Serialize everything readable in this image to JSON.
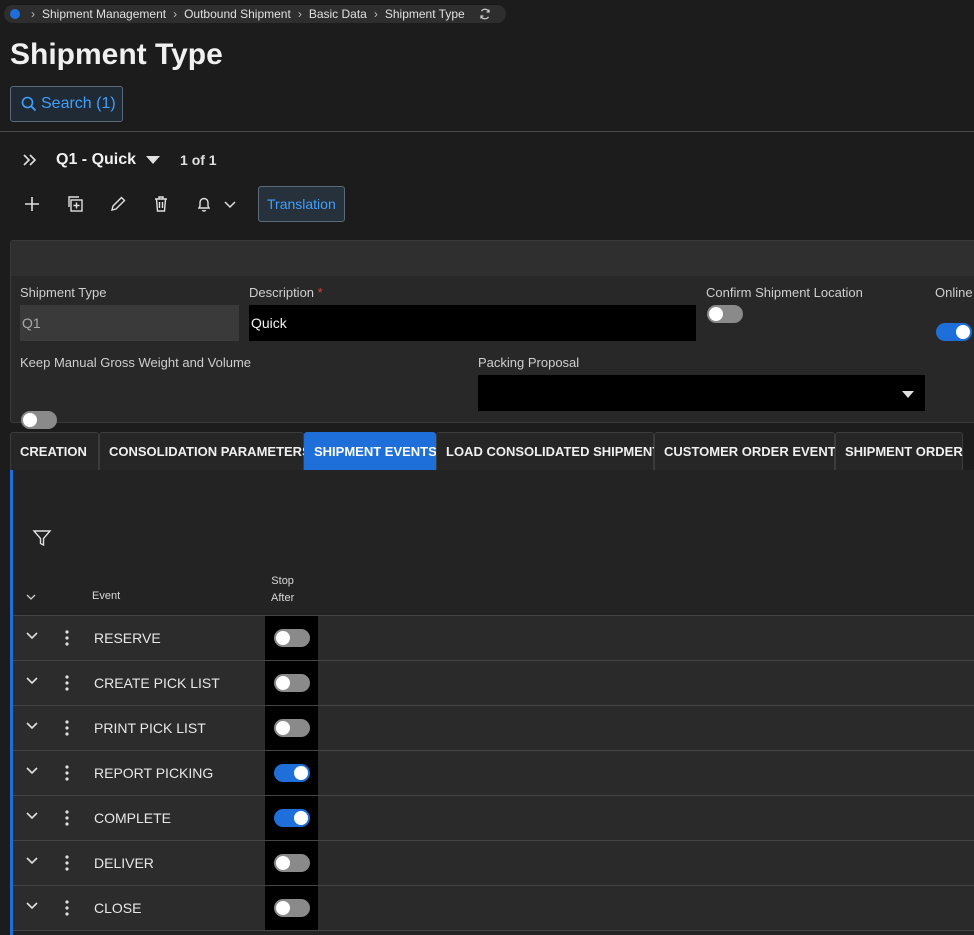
{
  "breadcrumb": {
    "items": [
      "Shipment Management",
      "Outbound Shipment",
      "Basic Data",
      "Shipment Type"
    ]
  },
  "page": {
    "title": "Shipment Type"
  },
  "search": {
    "label": "Search (1)"
  },
  "record": {
    "name": "Q1 - Quick",
    "count": "1 of 1"
  },
  "toolbar": {
    "translation_label": "Translation",
    "icons": [
      "add-icon",
      "duplicate-icon",
      "edit-icon",
      "delete-icon",
      "bell-icon",
      "chevron-down-icon"
    ]
  },
  "form": {
    "shipment_type_label": "Shipment Type",
    "shipment_type_value": "Q1",
    "description_label": "Description",
    "description_required": "*",
    "description_value": "Quick",
    "confirm_location_label": "Confirm Shipment Location",
    "confirm_location_on": false,
    "online_label": "Online",
    "online_on": true,
    "keep_manual_label": "Keep Manual Gross Weight and Volume",
    "keep_manual_on": false,
    "packing_proposal_label": "Packing Proposal",
    "packing_proposal_value": ""
  },
  "tabs": [
    {
      "label": "CREATION",
      "active": false
    },
    {
      "label": "CONSOLIDATION PARAMETERS",
      "active": false
    },
    {
      "label": "SHIPMENT EVENTS",
      "active": true
    },
    {
      "label": "LOAD CONSOLIDATED SHIPMENT",
      "active": false
    },
    {
      "label": "CUSTOMER ORDER EVENTS",
      "active": false
    },
    {
      "label": "SHIPMENT ORDER",
      "active": false
    }
  ],
  "grid": {
    "col_event": "Event",
    "col_stop_after_1": "Stop",
    "col_stop_after_2": "After",
    "rows": [
      {
        "event": "RESERVE",
        "stop_after": false
      },
      {
        "event": "CREATE PICK LIST",
        "stop_after": false
      },
      {
        "event": "PRINT PICK LIST",
        "stop_after": false
      },
      {
        "event": "REPORT PICKING",
        "stop_after": true
      },
      {
        "event": "COMPLETE",
        "stop_after": true
      },
      {
        "event": "DELIVER",
        "stop_after": false
      },
      {
        "event": "CLOSE",
        "stop_after": false
      }
    ]
  },
  "colors": {
    "accent": "#1e6fd9",
    "link": "#3ea0ff"
  }
}
